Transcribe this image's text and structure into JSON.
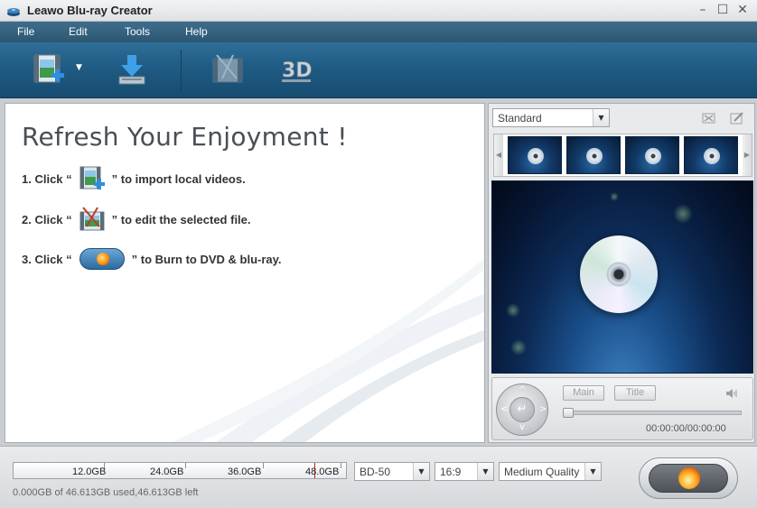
{
  "window": {
    "title": "Leawo Blu-ray Creator",
    "controls": {
      "minimize": "–",
      "restore": "☐",
      "close": "✕"
    }
  },
  "menu": {
    "items": [
      "File",
      "Edit",
      "Tools",
      "Help"
    ]
  },
  "toolbar": {
    "buttons": [
      {
        "name": "add-video",
        "icon": "film-add-icon"
      },
      {
        "name": "add-menu-dropdown",
        "icon": "chevron-down-icon",
        "glyph": "▼"
      },
      {
        "name": "burn-to-disc",
        "icon": "download-arrow-icon"
      },
      {
        "name": "edit",
        "icon": "film-edit-icon"
      },
      {
        "name": "3d",
        "icon": "3d-icon",
        "label": "3D"
      }
    ]
  },
  "welcome": {
    "title": "Refresh Your Enjoyment !",
    "steps": [
      {
        "prefix": "1. Click “",
        "suffix": "” to import local videos.",
        "icon": "film-add-icon"
      },
      {
        "prefix": "2. Click “",
        "suffix": "” to edit the selected file.",
        "icon": "film-edit-icon"
      },
      {
        "prefix": "3. Click “",
        "suffix": "” to Burn to DVD & blu-ray.",
        "icon": "burn-button-icon"
      }
    ]
  },
  "menu_template": {
    "selected": "Standard",
    "arrow": "▼",
    "thumbnail_count": 4,
    "strip_left": "◀",
    "strip_right": "▶"
  },
  "player": {
    "main_label": "Main",
    "title_label": "Title",
    "timecode": "00:00:00/00:00:00",
    "jog_center": "↵",
    "jog_left": "<",
    "jog_right": ">",
    "jog_up": "^",
    "jog_down": "v"
  },
  "capacity": {
    "ticks": [
      "12.0GB",
      "24.0GB",
      "36.0GB",
      "48.0GB"
    ],
    "usage": "0.000GB of 46.613GB used,46.613GB left"
  },
  "output_settings": {
    "disc_type": "BD-50",
    "aspect_ratio": "16:9",
    "quality": "Medium Quality",
    "arrow": "▼"
  },
  "colors": {
    "toolbar": "#1f5b84",
    "menubar": "#2c5672",
    "accent_flame": "#ff8a00",
    "capacity_limit": "#d2231d"
  }
}
